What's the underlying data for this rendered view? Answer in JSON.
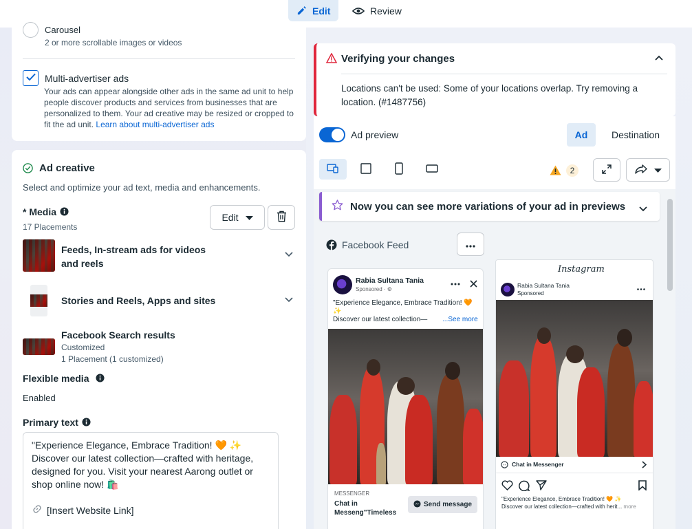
{
  "topbar": {
    "edit_label": "Edit",
    "review_label": "Review"
  },
  "format": {
    "carousel_label": "Carousel",
    "carousel_desc": "2 or more scrollable images or videos",
    "multi_label": "Multi-advertiser ads",
    "multi_desc": "Your ads can appear alongside other ads in the same ad unit to help people discover products and services from businesses that are personalized to them. Your ad creative may be resized or cropped to fit the ad unit.",
    "multi_link": "Learn about multi-advertiser ads",
    "multi_checked": true
  },
  "creative": {
    "title": "Ad creative",
    "subtitle": "Select and optimize your ad text, media and enhancements.",
    "media_label": "* Media",
    "placements": "17 Placements",
    "edit_label": "Edit",
    "items": [
      {
        "label_line1": "Feeds, In-stream ads for videos",
        "label_line2": "and reels"
      },
      {
        "label_line1": "Stories and Reels, Apps and sites"
      },
      {
        "label_line1": "Facebook Search results",
        "status": "Customized",
        "detail": "1 Placement (1 customized)"
      }
    ],
    "flexible_label": "Flexible media",
    "flexible_value": "Enabled",
    "primary_label": "Primary text",
    "primary_lines": [
      "\"Experience Elegance, Embrace Tradition! 🧡 ✨",
      "Discover our latest collection—crafted with heritage,",
      "designed for you. Visit your nearest Aarong outlet or",
      "shop online now! 🛍️"
    ],
    "link_placeholder": "[Insert Website Link]"
  },
  "verify": {
    "title": "Verifying your changes",
    "message_line1": "Locations can't be used: Some of your locations overlap. Try removing a",
    "message_line2": "location. (#1487756)"
  },
  "preview": {
    "toggle_label": "Ad preview",
    "toggle_on": true,
    "seg_ad": "Ad",
    "seg_destination": "Destination",
    "warning_count": "2",
    "banner": "Now you can see more variations of your ad in previews",
    "feed_label": "Facebook Feed",
    "fb": {
      "page_name": "Rabia Sultana Tania",
      "sponsored": "Sponsored · ⚙",
      "text_line1": "\"Experience Elegance, Embrace Tradition! 🧡",
      "text_line2": "✨",
      "text_line3": "Discover our latest collection—",
      "see_more": "...See more",
      "cta_top": "MESSENGER",
      "cta_line1": "Chat in",
      "cta_line2": "Messeng\"Timeless",
      "send_label": "Send message"
    },
    "ig": {
      "logo": "Instagram",
      "page_name": "Rabia Sultana Tania",
      "sponsored": "Sponsored",
      "chat_label": "Chat in Messenger",
      "caption_line1": "\"Experience Elegance, Embrace Tradition! 🧡 ✨",
      "caption_line2": "Discover our latest collection—crafted with herit...",
      "more": "more"
    }
  },
  "colors": {
    "accent": "#0a66d4",
    "error": "#e0263c",
    "warning": "#f5a623",
    "banner_accent": "#8a5cd1"
  }
}
